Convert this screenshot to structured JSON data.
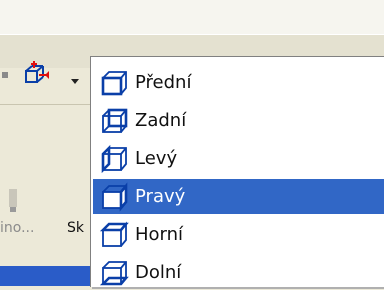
{
  "toolbar": {
    "view_button_icon": "view-orientation-cube-icon",
    "dropdown_arrow_icon": "chevron-down-icon"
  },
  "left_panel": {
    "label_gray": "ino...",
    "label_dark": "Sk"
  },
  "view_menu": {
    "items": [
      {
        "label": "Přední",
        "icon": "cube-front-face-icon",
        "selected": false
      },
      {
        "label": "Zadní",
        "icon": "cube-back-face-icon",
        "selected": false
      },
      {
        "label": "Levý",
        "icon": "cube-left-face-icon",
        "selected": false
      },
      {
        "label": "Pravý",
        "icon": "cube-right-face-icon",
        "selected": true
      },
      {
        "label": "Horní",
        "icon": "cube-top-face-icon",
        "selected": false
      },
      {
        "label": "Dolní",
        "icon": "cube-bottom-face-icon",
        "selected": false
      }
    ]
  },
  "colors": {
    "selection": "#3167C6",
    "icon_blue": "#0A3FA8",
    "menu_bg": "#FFFFFF",
    "toolbar_bg": "#ECE9D8"
  }
}
